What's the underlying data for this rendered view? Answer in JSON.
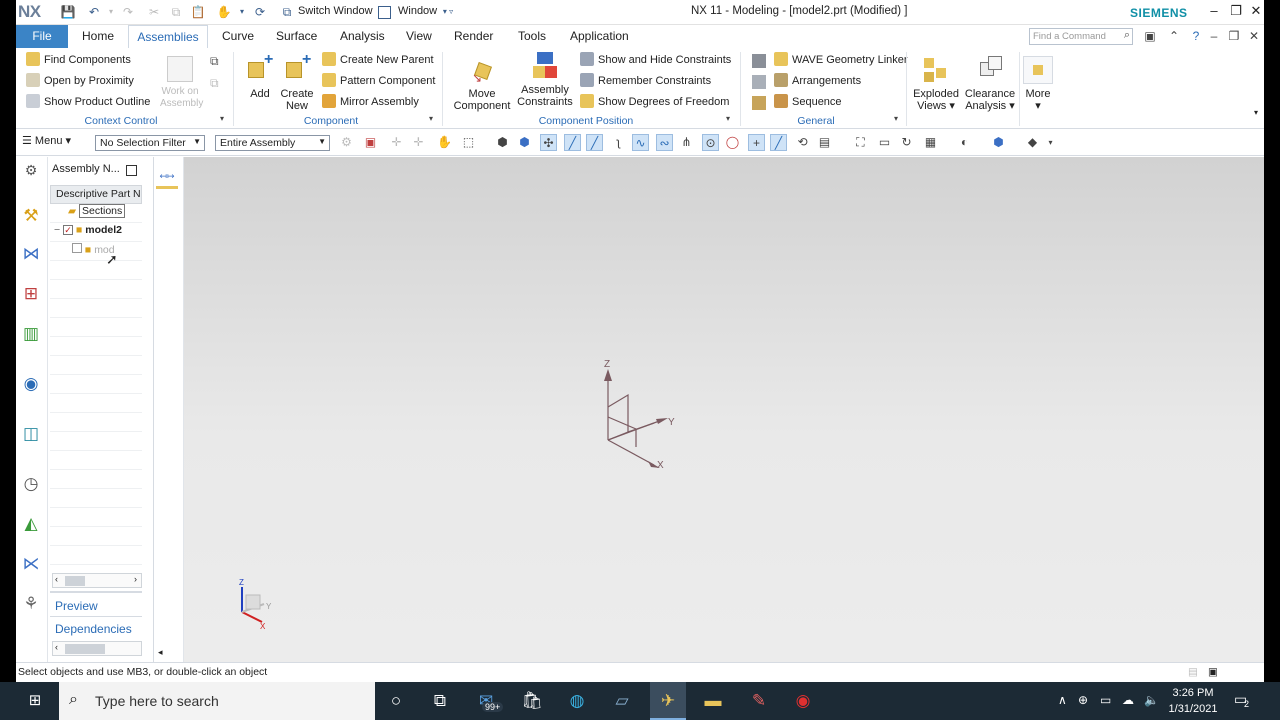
{
  "titlebar": {
    "logo": "NX",
    "switch_window": "Switch Window",
    "window_menu": "Window",
    "title": "NX 11 - Modeling - [model2.prt (Modified) ]",
    "brand": "SIEMENS",
    "brand_color": "#0f8fa6"
  },
  "tabs": [
    "File",
    "Home",
    "Assemblies",
    "Curve",
    "Surface",
    "Analysis",
    "View",
    "Render",
    "Tools",
    "Application"
  ],
  "active_tab": "Assemblies",
  "command_search": {
    "placeholder": "Find a Command"
  },
  "ribbon": {
    "context_control": {
      "title": "Context Control",
      "items": [
        "Find Components",
        "Open by Proximity",
        "Show Product Outline"
      ],
      "work_on_assembly": "Work on Assembly"
    },
    "component": {
      "title": "Component",
      "add": "Add",
      "create_new": "Create New",
      "items": [
        "Create New Parent",
        "Pattern Component",
        "Mirror Assembly"
      ]
    },
    "component_position": {
      "title": "Component Position",
      "move_component": "Move Component",
      "assembly_constraints": "Assembly Constraints",
      "items": [
        "Show and Hide Constraints",
        "Remember Constraints",
        "Show Degrees of Freedom"
      ]
    },
    "general": {
      "title": "General",
      "items": [
        "WAVE Geometry Linker",
        "Arrangements",
        "Sequence"
      ]
    },
    "exploded_views": "Exploded Views",
    "clearance_analysis": "Clearance Analysis",
    "more": "More"
  },
  "toolbar": {
    "menu": "Menu",
    "selection_filter": "No Selection Filter",
    "scope": "Entire Assembly"
  },
  "navigator": {
    "title": "Assembly N...",
    "column": "Descriptive Part N",
    "tree": [
      {
        "label": "Sections",
        "checked": false
      },
      {
        "label": "model2",
        "checked": true
      },
      {
        "label": "mod",
        "checked": false
      }
    ],
    "links": [
      "Preview",
      "Dependencies"
    ]
  },
  "viewport": {
    "axes": {
      "x": "X",
      "y": "Y",
      "z": "Z"
    }
  },
  "status": {
    "message": "Select objects and use MB3, or double-click an object"
  },
  "taskbar": {
    "search_placeholder": "Type here to search",
    "badge": "99+",
    "time": "3:26 PM",
    "date": "1/31/2021",
    "notification_count": "2"
  }
}
